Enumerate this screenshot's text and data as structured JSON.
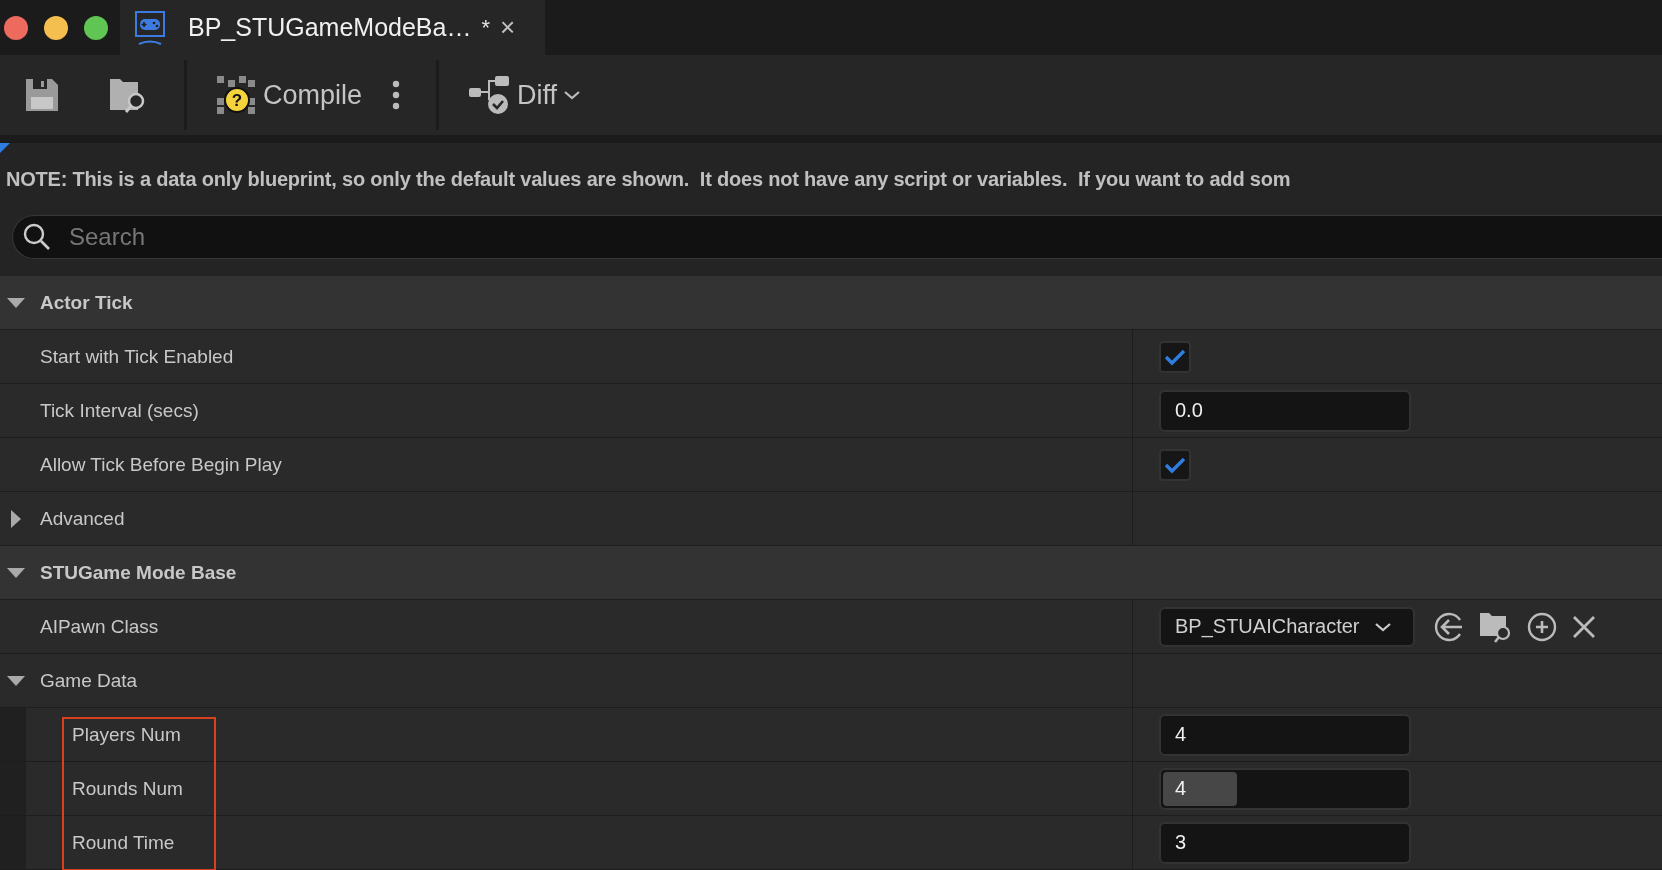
{
  "window": {
    "tab": {
      "title": "BP_STUGameModeBa…",
      "modified_mark": "*",
      "close": "×"
    }
  },
  "toolbar": {
    "compile_icon_mark": "?",
    "compile": "Compile",
    "diff": "Diff"
  },
  "note": "NOTE: This is a data only blueprint, so only the default values are shown.  It does not have any script or variables.  If you want to add som",
  "search": {
    "placeholder": "Search"
  },
  "categories": [
    {
      "label": "Actor Tick",
      "expanded": true,
      "children": [
        {
          "kind": "checkbox",
          "label": "Start with Tick Enabled",
          "checked": true
        },
        {
          "kind": "number",
          "label": "Tick Interval (secs)",
          "value": "0.0"
        },
        {
          "kind": "checkbox",
          "label": "Allow Tick Before Begin Play",
          "checked": true
        },
        {
          "kind": "group",
          "label": "Advanced",
          "expanded": false
        }
      ]
    },
    {
      "label": "STUGame Mode Base",
      "expanded": true,
      "children": [
        {
          "kind": "dropdown",
          "label": "AIPawn Class",
          "value": "BP_STUAICharacter"
        },
        {
          "kind": "group",
          "label": "Game Data",
          "expanded": true,
          "highlighted": true,
          "children": [
            {
              "kind": "number",
              "label": "Players Num",
              "value": "4"
            },
            {
              "kind": "slider",
              "label": "Rounds Num",
              "value": "4",
              "level": 0.3
            },
            {
              "kind": "number",
              "label": "Round Time",
              "value": "3"
            }
          ]
        }
      ]
    }
  ]
}
